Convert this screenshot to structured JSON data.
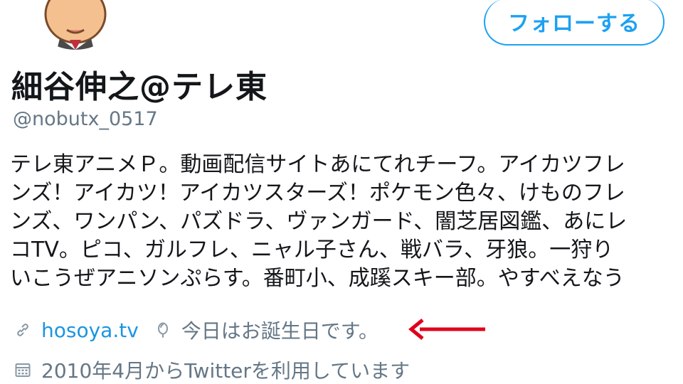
{
  "profile": {
    "display_name": "細谷伸之@テレ東",
    "handle": "@nobutx_0517",
    "follow_label": "フォローする",
    "bio_lines": [
      "テレ東アニメＰ。動画配信サイトあにてれチーフ。アイカツフレ",
      "ンズ！アイカツ！アイカツスターズ！ポケモン色々、けものフレ",
      "ンズ、ワンパン、パズドラ、ヴァンガード、闇芝居図鑑、あにレ",
      "コTV。ピコ、ガルフレ、ニャル子さん、戦バラ、牙狼。一狩り",
      "いこうぜアニソンぷらす。番町小、成蹊スキー部。やすべえなう"
    ],
    "website": "hosoya.tv",
    "birthday_text": "今日はお誕生日です。",
    "joined_text": "2010年4月からTwitterを利用しています"
  },
  "icons": {
    "link": "link-icon",
    "balloon": "balloon-icon",
    "calendar": "calendar-icon",
    "annotation": "red-arrow-icon"
  },
  "colors": {
    "accent": "#1da1f2",
    "link": "#1b95e0",
    "muted": "#657786",
    "text": "#14171a",
    "arrow": "#e0001b"
  }
}
